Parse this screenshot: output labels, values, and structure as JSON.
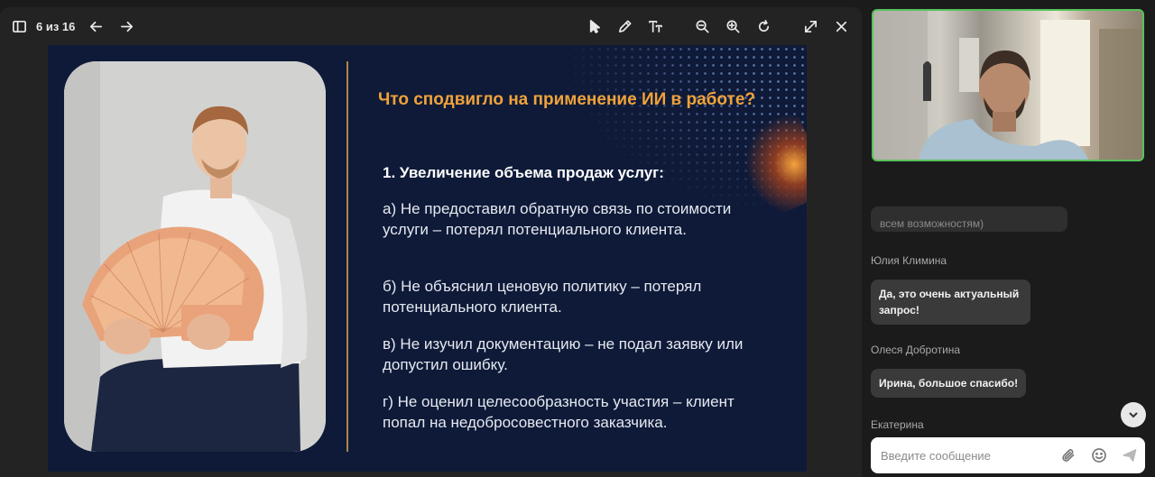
{
  "toolbar": {
    "page_counter": "6 из 16",
    "icons": [
      "sidebar-icon",
      "arrow-left-icon",
      "arrow-right-icon",
      "cursor-icon",
      "pen-icon",
      "text-icon",
      "zoom-out-icon",
      "zoom-in-icon",
      "rotate-icon",
      "fullscreen-icon",
      "close-icon"
    ]
  },
  "slide": {
    "title": "Что сподвигло на применение ИИ в работе?",
    "subtitle": "1. Увеличение объема продаж услуг:",
    "points": [
      "а) Не предоставил обратную связь по стоимости услуги – потерял потенциального клиента.",
      "б) Не объяснил ценовую политику – потерял потенциального клиента.",
      "в) Не изучил документацию – не подал заявку или допустил ошибку.",
      "г) Не оценил целесообразность участия – клиент попал на недобросовестного заказчика."
    ],
    "accent_color": "#f0a23a",
    "background_color": "#0e1a38"
  },
  "chat": {
    "cut_message": "всем возможностям)",
    "messages": [
      {
        "author": "Юлия Климина",
        "text": "Да, это очень актуальный запрос!"
      },
      {
        "author": "Олеся Добротина",
        "text": "Ирина, большое спасибо!"
      },
      {
        "author": "Екатерина",
        "text": ""
      }
    ],
    "input_placeholder": "Введите сообщение"
  },
  "colors": {
    "video_border": "#57c25b",
    "panel_bg": "#1b1b1b"
  }
}
